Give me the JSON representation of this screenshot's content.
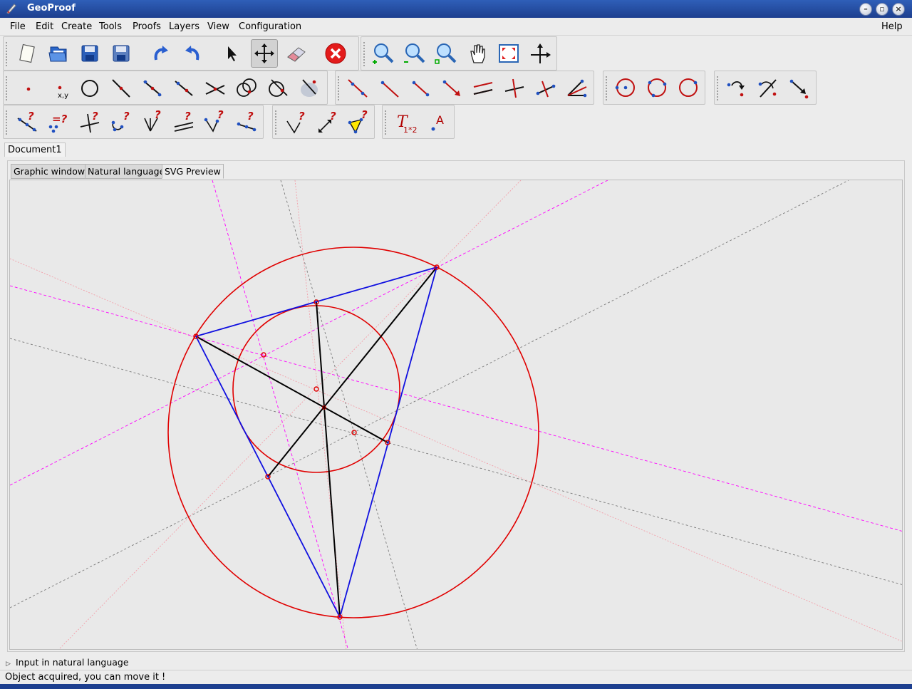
{
  "window": {
    "title": "GeoProof"
  },
  "menubar": {
    "items": [
      "File",
      "Edit",
      "Create",
      "Tools",
      "Proofs",
      "Layers",
      "View",
      "Configuration"
    ],
    "help": "Help"
  },
  "toolbars": {
    "file_edit": [
      {
        "name": "new-document-icon"
      },
      {
        "name": "open-file-icon"
      },
      {
        "name": "save-icon"
      },
      {
        "name": "save-as-icon"
      },
      {
        "name": "redo-icon"
      },
      {
        "name": "undo-icon"
      },
      {
        "name": "select-arrow-icon"
      },
      {
        "name": "move-cross-icon",
        "active": true
      },
      {
        "name": "eraser-icon"
      },
      {
        "name": "stop-delete-icon"
      }
    ],
    "view": [
      {
        "name": "zoom-in-icon"
      },
      {
        "name": "zoom-out-icon"
      },
      {
        "name": "zoom-fit-icon"
      },
      {
        "name": "pan-hand-icon"
      },
      {
        "name": "fit-window-icon"
      },
      {
        "name": "axes-icon"
      }
    ],
    "creation_points": [
      {
        "name": "point-icon"
      },
      {
        "name": "point-coordinates-icon",
        "caption": "x,y"
      },
      {
        "name": "circle-icon"
      },
      {
        "name": "segment-icon"
      },
      {
        "name": "midpoint-icon"
      },
      {
        "name": "point-on-line-icon"
      },
      {
        "name": "intersection-lines-icon"
      },
      {
        "name": "intersection-circles-icon"
      },
      {
        "name": "intersection-line-circle-icon"
      },
      {
        "name": "locus-icon"
      }
    ],
    "creation_lines": [
      {
        "name": "line-icon"
      },
      {
        "name": "ray-icon"
      },
      {
        "name": "segment-line-icon"
      },
      {
        "name": "vector-icon"
      },
      {
        "name": "parallel-icon"
      },
      {
        "name": "perpendicular-icon"
      },
      {
        "name": "perpendicular-bisector-icon"
      },
      {
        "name": "angle-bisector-icon"
      }
    ],
    "creation_circles": [
      {
        "name": "circle-center-point-icon"
      },
      {
        "name": "circle-three-points-icon"
      },
      {
        "name": "circle-center-radius-icon"
      }
    ],
    "transformations": [
      {
        "name": "rotation-icon"
      },
      {
        "name": "reflection-icon"
      },
      {
        "name": "translation-icon"
      }
    ],
    "properties": [
      {
        "name": "collinear-check-icon",
        "mark": "?"
      },
      {
        "name": "equal-check-icon",
        "mark": "=?"
      },
      {
        "name": "perpendicular-check-icon",
        "mark": "?"
      },
      {
        "name": "concyclic-check-icon",
        "mark": "?"
      },
      {
        "name": "concurrent-check-icon",
        "mark": "?"
      },
      {
        "name": "parallel-check-icon",
        "mark": "?"
      },
      {
        "name": "angle-check-icon",
        "mark": "?"
      },
      {
        "name": "midpoint-check-icon",
        "mark": "?"
      }
    ],
    "properties2": [
      {
        "name": "angle-equal-check-icon",
        "mark": "?"
      },
      {
        "name": "distance-check-icon",
        "mark": "?"
      },
      {
        "name": "triangle-check-icon",
        "mark": "?"
      }
    ],
    "text": [
      {
        "name": "text-formula-icon",
        "label": "T",
        "sub": "1*2"
      },
      {
        "name": "label-point-icon",
        "label": "A"
      }
    ]
  },
  "document_tab": "Document1",
  "view_tabs": [
    "Graphic window",
    "Natural language",
    "SVG Preview"
  ],
  "selected_view_tab": 2,
  "colors": {
    "accent_red": "#e00000",
    "triangle_blue": "#1010e0",
    "cevian_black": "#000000",
    "magenta_dashed": "#ff00ff",
    "pink_dotted": "#f0a0a8",
    "gray_dashed": "#777777"
  },
  "expander_label": "Input in natural language",
  "status": "Object acquired, you can move it !"
}
